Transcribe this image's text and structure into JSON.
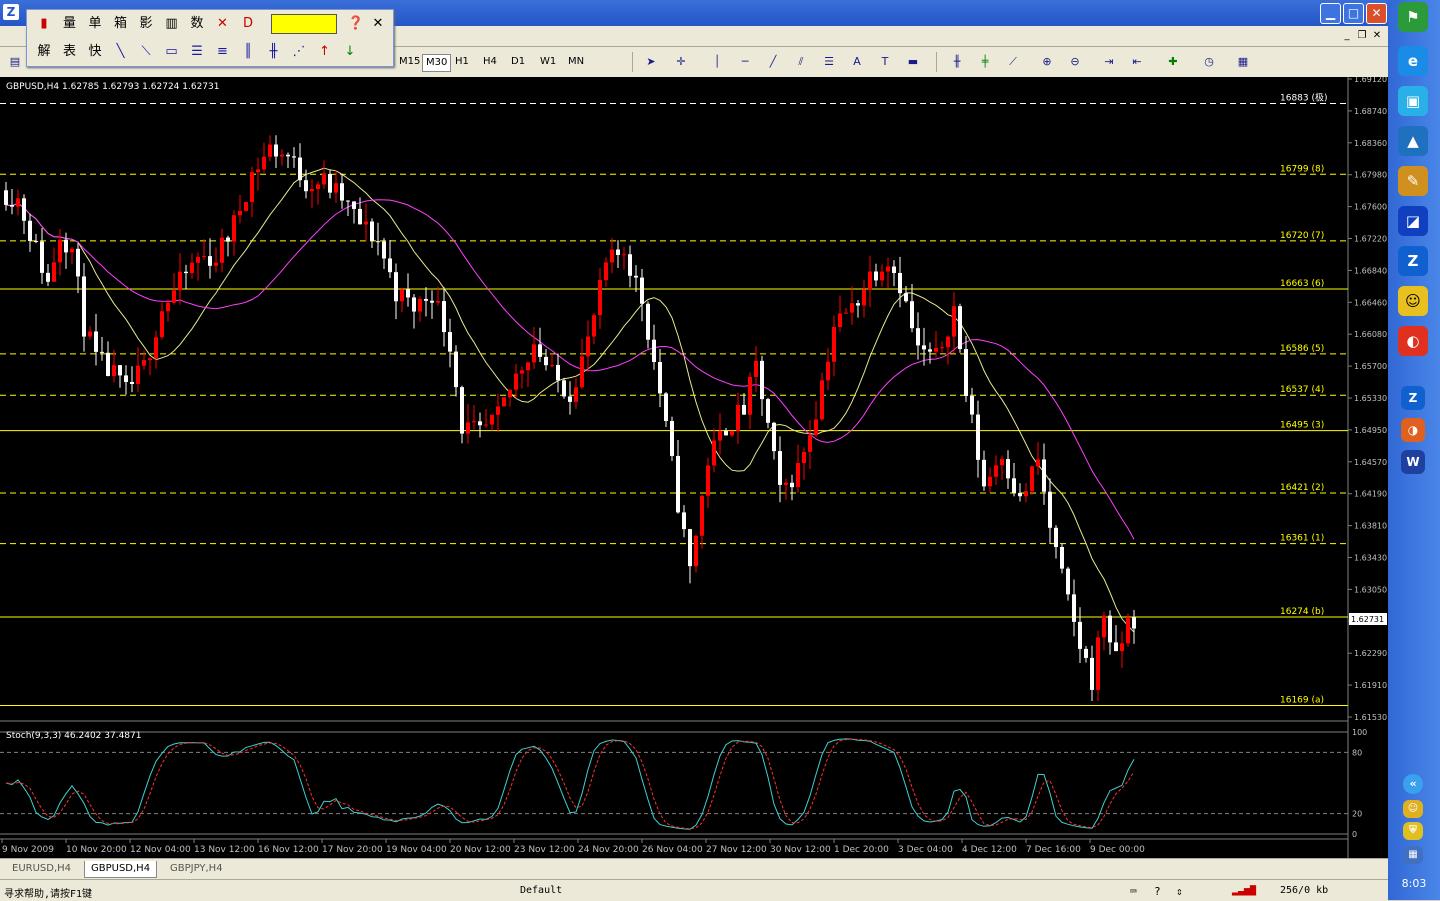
{
  "window": {
    "icon": "Z"
  },
  "float_toolbar": {
    "row1": [
      "量",
      "单",
      "箱",
      "影",
      "数"
    ],
    "row2": [
      "解",
      "表",
      "快"
    ],
    "color": "#ffff00"
  },
  "timeframes": [
    "M15",
    "M30",
    "H1",
    "H4",
    "D1",
    "W1",
    "MN"
  ],
  "active_timeframe": "M30",
  "chart": {
    "header": "GBPUSD,H4  1.62785 1.62793 1.62724 1.62731",
    "current_price": "1.62731",
    "stoch_header": "Stoch(9,3,3) 46.2402 37.4871",
    "price_labels": [
      "1.69120",
      "1.68740",
      "1.68360",
      "1.67980",
      "1.67600",
      "1.67220",
      "1.66840",
      "1.66460",
      "1.66080",
      "1.65700",
      "1.65330",
      "1.64950",
      "1.64570",
      "1.64190",
      "1.63810",
      "1.63430",
      "1.63050",
      "1.62670",
      "1.62290",
      "1.61910",
      "1.61530"
    ],
    "price_min": 1.6153,
    "price_max": 1.6912,
    "levels": [
      {
        "label": "16883 (极)",
        "price": 1.6883,
        "color": "#ffffff",
        "dash": true
      },
      {
        "label": "16799 (8)",
        "price": 1.6799,
        "color": "#ffff00",
        "dash": true
      },
      {
        "label": "16720 (7)",
        "price": 1.672,
        "color": "#ffff00",
        "dash": true
      },
      {
        "label": "16663 (6)",
        "price": 1.6663,
        "color": "#ffff00",
        "dash": false
      },
      {
        "label": "16586 (5)",
        "price": 1.6586,
        "color": "#ffff00",
        "dash": true
      },
      {
        "label": "16537 (4)",
        "price": 1.6537,
        "color": "#ffff00",
        "dash": true
      },
      {
        "label": "16495 (3)",
        "price": 1.6495,
        "color": "#ffff00",
        "dash": false
      },
      {
        "label": "16421 (2)",
        "price": 1.6421,
        "color": "#ffff00",
        "dash": true
      },
      {
        "label": "16361 (1)",
        "price": 1.6361,
        "color": "#ffff00",
        "dash": true
      },
      {
        "label": "16274 (b)",
        "price": 1.6274,
        "color": "#ffff00",
        "dash": false
      },
      {
        "label": "16169 (a)",
        "price": 1.6169,
        "color": "#ffff00",
        "dash": false
      }
    ],
    "stoch_levels": [
      "100",
      "80",
      "20",
      "0"
    ],
    "dates": [
      "9 Nov 2009",
      "10 Nov 20:00",
      "12 Nov 04:00",
      "13 Nov 12:00",
      "16 Nov 12:00",
      "17 Nov 20:00",
      "19 Nov 04:00",
      "20 Nov 12:00",
      "23 Nov 12:00",
      "24 Nov 20:00",
      "26 Nov 04:00",
      "27 Nov 12:00",
      "30 Nov 12:00",
      "1 Dec 20:00",
      "3 Dec 04:00",
      "4 Dec 12:00",
      "7 Dec 16:00",
      "9 Dec 00:00"
    ],
    "colors": {
      "bull": "#ff0000",
      "bear": "#ffffff",
      "ma_fast": "#e8e890",
      "ma_slow": "#ff40ff",
      "stoch_k": "#40d0d0",
      "stoch_d": "#ff3030",
      "grid": "#808080"
    }
  },
  "chart_data": {
    "type": "candlestick",
    "symbol": "GBPUSD",
    "timeframe": "H4",
    "ylim": [
      1.6153,
      1.6912
    ],
    "anchors": [
      {
        "t": 0,
        "p": 1.678
      },
      {
        "t": 3,
        "p": 1.677
      },
      {
        "t": 6,
        "p": 1.671
      },
      {
        "t": 8,
        "p": 1.667
      },
      {
        "t": 10,
        "p": 1.673
      },
      {
        "t": 12,
        "p": 1.671
      },
      {
        "t": 14,
        "p": 1.662
      },
      {
        "t": 16,
        "p": 1.658
      },
      {
        "t": 19,
        "p": 1.656
      },
      {
        "t": 21,
        "p": 1.654
      },
      {
        "t": 24,
        "p": 1.657
      },
      {
        "t": 27,
        "p": 1.664
      },
      {
        "t": 30,
        "p": 1.667
      },
      {
        "t": 33,
        "p": 1.67
      },
      {
        "t": 36,
        "p": 1.67
      },
      {
        "t": 39,
        "p": 1.674
      },
      {
        "t": 42,
        "p": 1.68
      },
      {
        "t": 45,
        "p": 1.683
      },
      {
        "t": 48,
        "p": 1.682
      },
      {
        "t": 51,
        "p": 1.679
      },
      {
        "t": 54,
        "p": 1.679
      },
      {
        "t": 57,
        "p": 1.677
      },
      {
        "t": 60,
        "p": 1.674
      },
      {
        "t": 63,
        "p": 1.672
      },
      {
        "t": 66,
        "p": 1.666
      },
      {
        "t": 69,
        "p": 1.664
      },
      {
        "t": 72,
        "p": 1.666
      },
      {
        "t": 75,
        "p": 1.66
      },
      {
        "t": 77,
        "p": 1.65
      },
      {
        "t": 80,
        "p": 1.649
      },
      {
        "t": 83,
        "p": 1.651
      },
      {
        "t": 86,
        "p": 1.656
      },
      {
        "t": 89,
        "p": 1.66
      },
      {
        "t": 92,
        "p": 1.656
      },
      {
        "t": 95,
        "p": 1.654
      },
      {
        "t": 98,
        "p": 1.66
      },
      {
        "t": 101,
        "p": 1.669
      },
      {
        "t": 104,
        "p": 1.671
      },
      {
        "t": 107,
        "p": 1.665
      },
      {
        "t": 110,
        "p": 1.654
      },
      {
        "t": 113,
        "p": 1.641
      },
      {
        "t": 115,
        "p": 1.633
      },
      {
        "t": 118,
        "p": 1.646
      },
      {
        "t": 121,
        "p": 1.65
      },
      {
        "t": 124,
        "p": 1.652
      },
      {
        "t": 126,
        "p": 1.657
      },
      {
        "t": 128,
        "p": 1.65
      },
      {
        "t": 130,
        "p": 1.642
      },
      {
        "t": 133,
        "p": 1.645
      },
      {
        "t": 136,
        "p": 1.652
      },
      {
        "t": 139,
        "p": 1.662
      },
      {
        "t": 142,
        "p": 1.664
      },
      {
        "t": 145,
        "p": 1.668
      },
      {
        "t": 148,
        "p": 1.67
      },
      {
        "t": 150,
        "p": 1.667
      },
      {
        "t": 153,
        "p": 1.659
      },
      {
        "t": 156,
        "p": 1.658
      },
      {
        "t": 159,
        "p": 1.664
      },
      {
        "t": 161,
        "p": 1.654
      },
      {
        "t": 164,
        "p": 1.643
      },
      {
        "t": 167,
        "p": 1.647
      },
      {
        "t": 170,
        "p": 1.641
      },
      {
        "t": 173,
        "p": 1.646
      },
      {
        "t": 175,
        "p": 1.638
      },
      {
        "t": 178,
        "p": 1.629
      },
      {
        "t": 180,
        "p": 1.624
      },
      {
        "t": 182,
        "p": 1.62
      },
      {
        "t": 184,
        "p": 1.628
      },
      {
        "t": 186,
        "p": 1.622
      },
      {
        "t": 188,
        "p": 1.627
      }
    ]
  },
  "tabs": [
    "EURUSD,H4",
    "GBPUSD,H4",
    "GBPJPY,H4"
  ],
  "active_tab": "GBPUSD,H4",
  "status": {
    "help": "寻求帮助,请按F1键",
    "profile": "Default",
    "traffic": "256/0 kb"
  },
  "clock": "8:03"
}
